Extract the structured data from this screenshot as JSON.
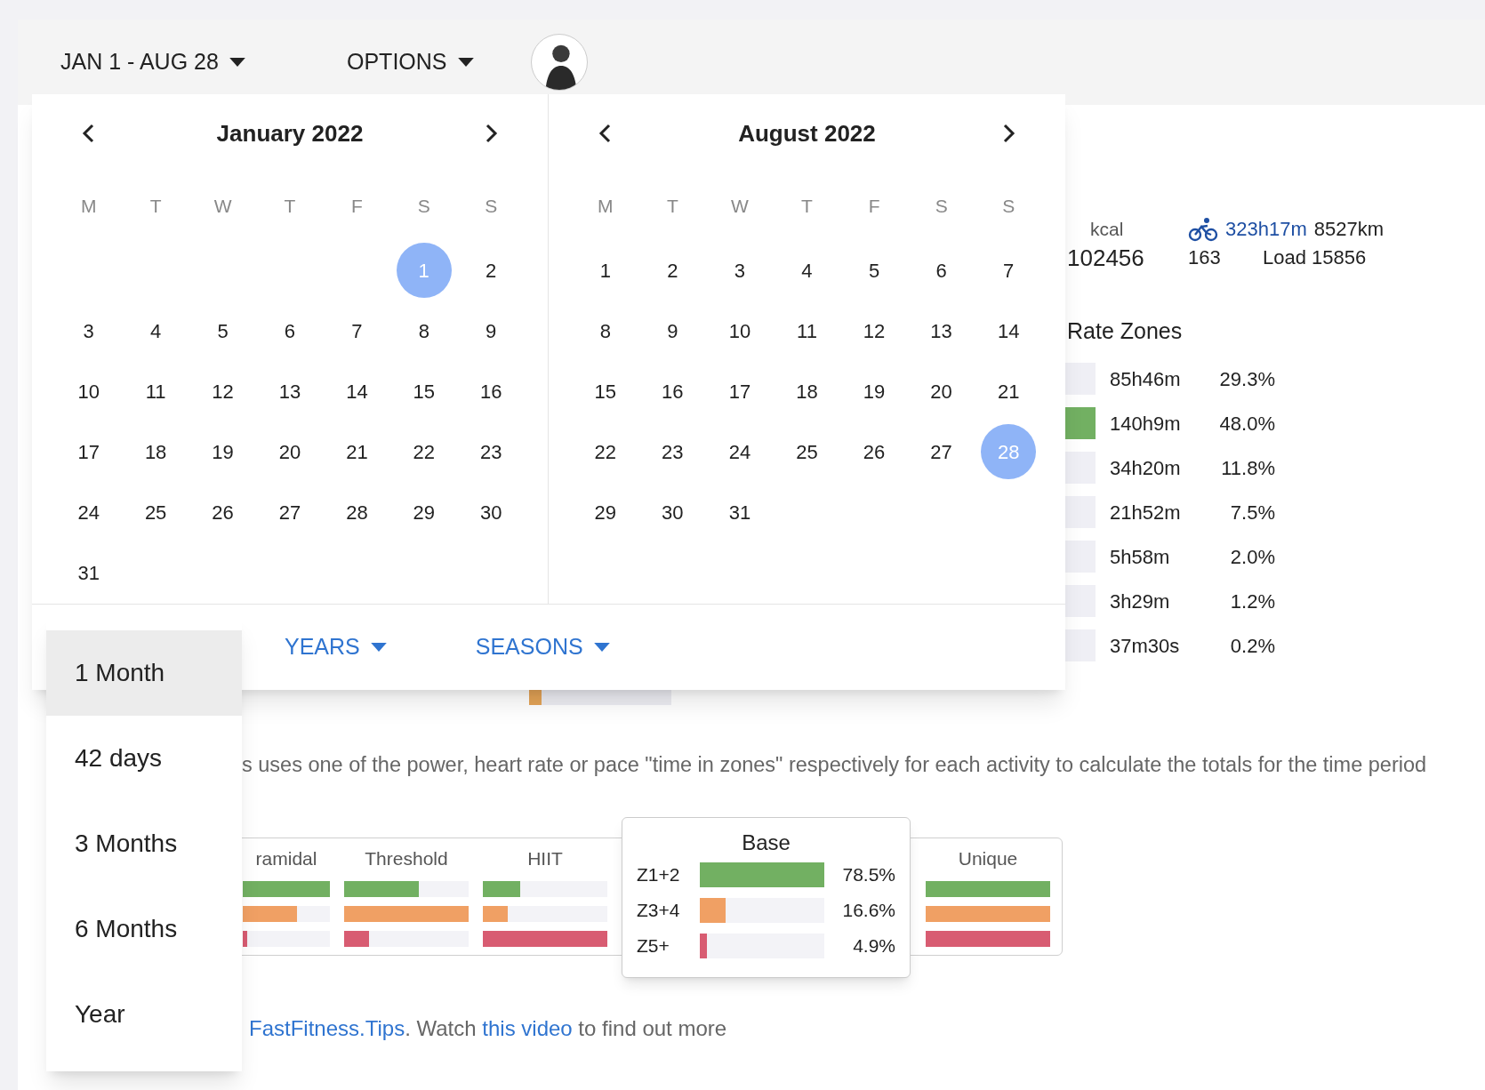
{
  "header": {
    "date_range": "JAN 1 - AUG 28",
    "options": "OPTIONS"
  },
  "stats": {
    "kcal_label": "kcal",
    "kcal": "102456",
    "count": "163",
    "ride_time": "323h17m",
    "distance": "8527km",
    "load": "Load 15856"
  },
  "rate_zones": {
    "title": "Rate Zones",
    "rows": [
      {
        "time": "85h46m",
        "percent": "29.3%",
        "highlighted": false
      },
      {
        "time": "140h9m",
        "percent": "48.0%",
        "highlighted": true
      },
      {
        "time": "34h20m",
        "percent": "11.8%",
        "highlighted": false
      },
      {
        "time": "21h52m",
        "percent": "7.5%",
        "highlighted": false
      },
      {
        "time": "5h58m",
        "percent": "2.0%",
        "highlighted": false
      },
      {
        "time": "3h29m",
        "percent": "1.2%",
        "highlighted": false
      },
      {
        "time": "37m30s",
        "percent": "0.2%",
        "highlighted": false
      }
    ]
  },
  "covered_bar": {
    "level": 0.09
  },
  "description": "s uses one of the power, heart rate or pace \"time in zones\" respectively for each activity to calculate the totals for the time period",
  "zone_table": {
    "columns": [
      {
        "title": "ramidal",
        "bars": [
          {
            "level": 1
          },
          {
            "level": 0.62
          },
          {
            "level": 0.05
          }
        ]
      },
      {
        "title": "Threshold",
        "bars": [
          {
            "level": 0.6
          },
          {
            "level": 1
          },
          {
            "level": 0.2
          }
        ]
      },
      {
        "title": "HIIT",
        "bars": [
          {
            "level": 0.3
          },
          {
            "level": 0.2
          },
          {
            "level": 1
          }
        ]
      },
      {
        "title": "Unique",
        "bars": [
          {
            "level": 1
          },
          {
            "level": 1
          },
          {
            "level": 1
          }
        ]
      }
    ]
  },
  "tooltip": {
    "title": "Base",
    "rows": [
      {
        "label": "Z1+2",
        "level": 1,
        "percent": "78.5%"
      },
      {
        "label": "Z3+4",
        "level": 0.21,
        "percent": "16.6%"
      },
      {
        "label": "Z5+",
        "level": 0.06,
        "percent": "4.9%"
      }
    ]
  },
  "footer_text": [
    {
      "text": "FastFitness.Tips",
      "kind": "link"
    },
    {
      "text": ". Watch ",
      "kind": "plain"
    },
    {
      "text": "this video",
      "kind": "link"
    },
    {
      "text": " to find out more",
      "kind": "plain"
    }
  ],
  "calendar": {
    "months": [
      {
        "title": "January 2022",
        "first_week_right_aligned": true,
        "weekdays": [
          "M",
          "T",
          "W",
          "T",
          "F",
          "S",
          "S"
        ],
        "weeks": [
          [
            {
              "d": "1",
              "selected": true
            },
            {
              "d": "2",
              "selected": false
            }
          ],
          [
            {
              "d": "3",
              "selected": false
            },
            {
              "d": "4",
              "selected": false
            },
            {
              "d": "5",
              "selected": false
            },
            {
              "d": "6",
              "selected": false
            },
            {
              "d": "7",
              "selected": false
            },
            {
              "d": "8",
              "selected": false
            },
            {
              "d": "9",
              "selected": false
            }
          ],
          [
            {
              "d": "10",
              "selected": false
            },
            {
              "d": "11",
              "selected": false
            },
            {
              "d": "12",
              "selected": false
            },
            {
              "d": "13",
              "selected": false
            },
            {
              "d": "14",
              "selected": false
            },
            {
              "d": "15",
              "selected": false
            },
            {
              "d": "16",
              "selected": false
            }
          ],
          [
            {
              "d": "17",
              "selected": false
            },
            {
              "d": "18",
              "selected": false
            },
            {
              "d": "19",
              "selected": false
            },
            {
              "d": "20",
              "selected": false
            },
            {
              "d": "21",
              "selected": false
            },
            {
              "d": "22",
              "selected": false
            },
            {
              "d": "23",
              "selected": false
            }
          ],
          [
            {
              "d": "24",
              "selected": false
            },
            {
              "d": "25",
              "selected": false
            },
            {
              "d": "26",
              "selected": false
            },
            {
              "d": "27",
              "selected": false
            },
            {
              "d": "28",
              "selected": false
            },
            {
              "d": "29",
              "selected": false
            },
            {
              "d": "30",
              "selected": false
            }
          ],
          [
            {
              "d": "31",
              "selected": false
            }
          ]
        ]
      },
      {
        "title": "August 2022",
        "weekdays": [
          "M",
          "T",
          "W",
          "T",
          "F",
          "S",
          "S"
        ],
        "weeks": [
          [
            {
              "d": "1",
              "selected": false
            },
            {
              "d": "2",
              "selected": false
            },
            {
              "d": "3",
              "selected": false
            },
            {
              "d": "4",
              "selected": false
            },
            {
              "d": "5",
              "selected": false
            },
            {
              "d": "6",
              "selected": false
            },
            {
              "d": "7",
              "selected": false
            }
          ],
          [
            {
              "d": "8",
              "selected": false
            },
            {
              "d": "9",
              "selected": false
            },
            {
              "d": "10",
              "selected": false
            },
            {
              "d": "11",
              "selected": false
            },
            {
              "d": "12",
              "selected": false
            },
            {
              "d": "13",
              "selected": false
            },
            {
              "d": "14",
              "selected": false
            }
          ],
          [
            {
              "d": "15",
              "selected": false
            },
            {
              "d": "16",
              "selected": false
            },
            {
              "d": "17",
              "selected": false
            },
            {
              "d": "18",
              "selected": false
            },
            {
              "d": "19",
              "selected": false
            },
            {
              "d": "20",
              "selected": false
            },
            {
              "d": "21",
              "selected": false
            }
          ],
          [
            {
              "d": "22",
              "selected": false
            },
            {
              "d": "23",
              "selected": false
            },
            {
              "d": "24",
              "selected": false
            },
            {
              "d": "25",
              "selected": false
            },
            {
              "d": "26",
              "selected": false
            },
            {
              "d": "27",
              "selected": false
            },
            {
              "d": "28",
              "selected": true
            }
          ],
          [
            {
              "d": "29",
              "selected": false
            },
            {
              "d": "30",
              "selected": false
            },
            {
              "d": "31",
              "selected": false
            }
          ]
        ]
      }
    ],
    "footer_buttons": [
      "YEARS",
      "SEASONS"
    ]
  },
  "range_menu": [
    {
      "label": "1 Month",
      "selected": true
    },
    {
      "label": "42 days",
      "selected": false
    },
    {
      "label": "3 Months",
      "selected": false
    },
    {
      "label": "6 Months",
      "selected": false
    },
    {
      "label": "Year",
      "selected": false
    }
  ]
}
